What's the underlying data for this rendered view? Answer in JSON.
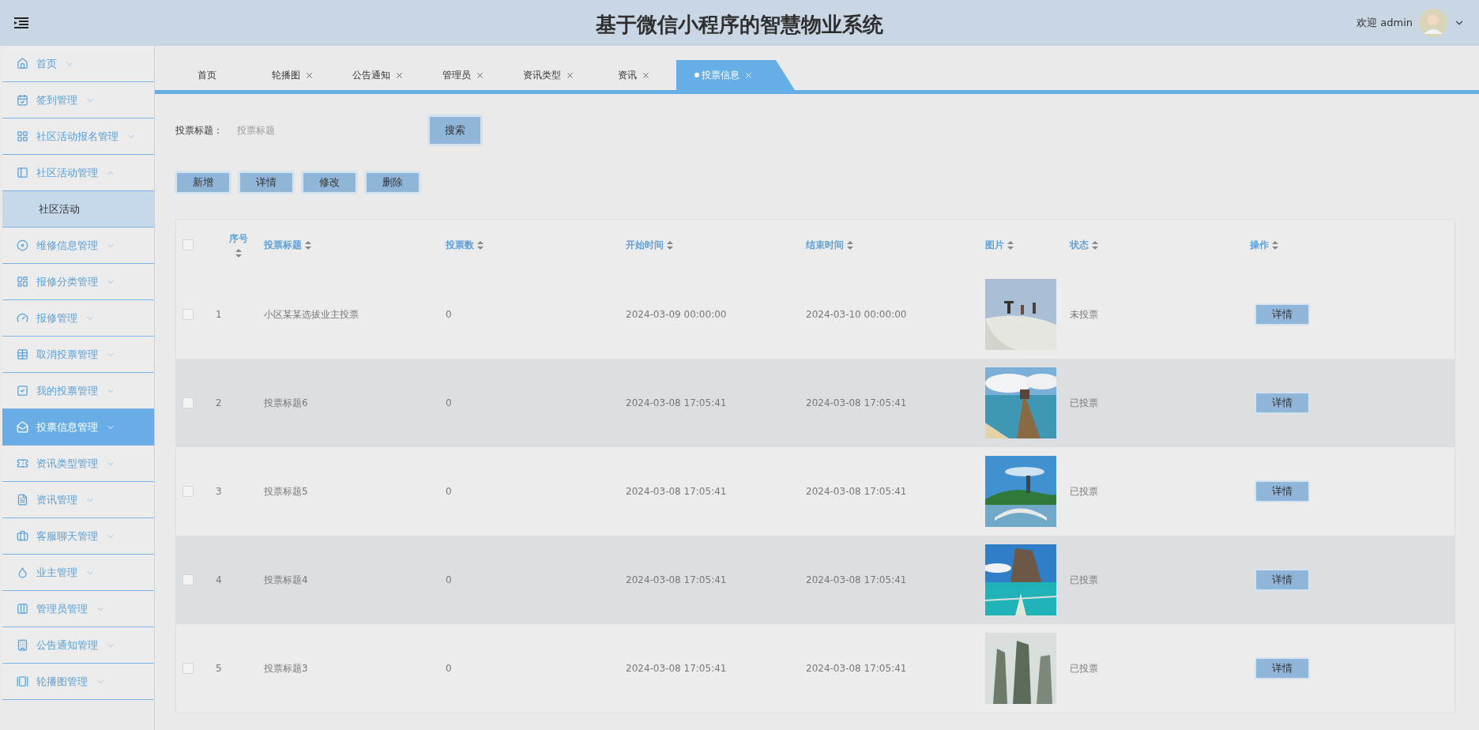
{
  "header": {
    "title": "基于微信小程序的智慧物业系统",
    "welcome": "欢迎 admin"
  },
  "sidebar": {
    "items": [
      {
        "label": "首页",
        "selected": false,
        "expanded": false
      },
      {
        "label": "签到管理",
        "selected": false,
        "expanded": false
      },
      {
        "label": "社区活动报名管理",
        "selected": false,
        "expanded": false
      },
      {
        "label": "社区活动管理",
        "selected": false,
        "expanded": true,
        "children": [
          {
            "label": "社区活动",
            "highlighted": true
          }
        ]
      },
      {
        "label": "维修信息管理",
        "selected": false,
        "expanded": false
      },
      {
        "label": "报修分类管理",
        "selected": false,
        "expanded": false
      },
      {
        "label": "报修管理",
        "selected": false,
        "expanded": false
      },
      {
        "label": "取消投票管理",
        "selected": false,
        "expanded": false
      },
      {
        "label": "我的投票管理",
        "selected": false,
        "expanded": false
      },
      {
        "label": "投票信息管理",
        "selected": true,
        "expanded": false
      },
      {
        "label": "资讯类型管理",
        "selected": false,
        "expanded": false
      },
      {
        "label": "资讯管理",
        "selected": false,
        "expanded": false
      },
      {
        "label": "客服聊天管理",
        "selected": false,
        "expanded": false
      },
      {
        "label": "业主管理",
        "selected": false,
        "expanded": false
      },
      {
        "label": "管理员管理",
        "selected": false,
        "expanded": false
      },
      {
        "label": "公告通知管理",
        "selected": false,
        "expanded": false
      },
      {
        "label": "轮播图管理",
        "selected": false,
        "expanded": false
      }
    ]
  },
  "tabs": [
    {
      "label": "首页",
      "selected": false,
      "closable": false
    },
    {
      "label": "轮播图",
      "selected": false,
      "closable": true
    },
    {
      "label": "公告通知",
      "selected": false,
      "closable": true
    },
    {
      "label": "管理员",
      "selected": false,
      "closable": true
    },
    {
      "label": "资讯类型",
      "selected": false,
      "closable": true
    },
    {
      "label": "资讯",
      "selected": false,
      "closable": true
    },
    {
      "label": "投票信息",
      "selected": true,
      "closable": true
    }
  ],
  "search": {
    "label": "投票标题：",
    "placeholder": "投票标题",
    "button": "搜索"
  },
  "actions": [
    "新增",
    "详情",
    "修改",
    "删除"
  ],
  "table": {
    "header_checked": false,
    "columns": [
      "序号",
      "投票标题",
      "投票数",
      "开始时间",
      "结束时间",
      "图片",
      "状态",
      "操作"
    ],
    "rows": [
      {
        "checked": false,
        "index": "1",
        "title": "小区某某选拔业主投票",
        "votes": "0",
        "start": "2024-03-09 00:00:00",
        "end": "2024-03-10 00:00:00",
        "status": "未投票",
        "action": "详情"
      },
      {
        "checked": false,
        "index": "2",
        "title": "投票标题6",
        "votes": "0",
        "start": "2024-03-08 17:05:41",
        "end": "2024-03-08 17:05:41",
        "status": "已投票",
        "action": "详情"
      },
      {
        "checked": false,
        "index": "3",
        "title": "投票标题5",
        "votes": "0",
        "start": "2024-03-08 17:05:41",
        "end": "2024-03-08 17:05:41",
        "status": "已投票",
        "action": "详情"
      },
      {
        "checked": false,
        "index": "4",
        "title": "投票标题4",
        "votes": "0",
        "start": "2024-03-08 17:05:41",
        "end": "2024-03-08 17:05:41",
        "status": "已投票",
        "action": "详情"
      },
      {
        "checked": false,
        "index": "5",
        "title": "投票标题3",
        "votes": "0",
        "start": "2024-03-08 17:05:41",
        "end": "2024-03-08 17:05:41",
        "status": "已投票",
        "action": "详情"
      }
    ]
  }
}
